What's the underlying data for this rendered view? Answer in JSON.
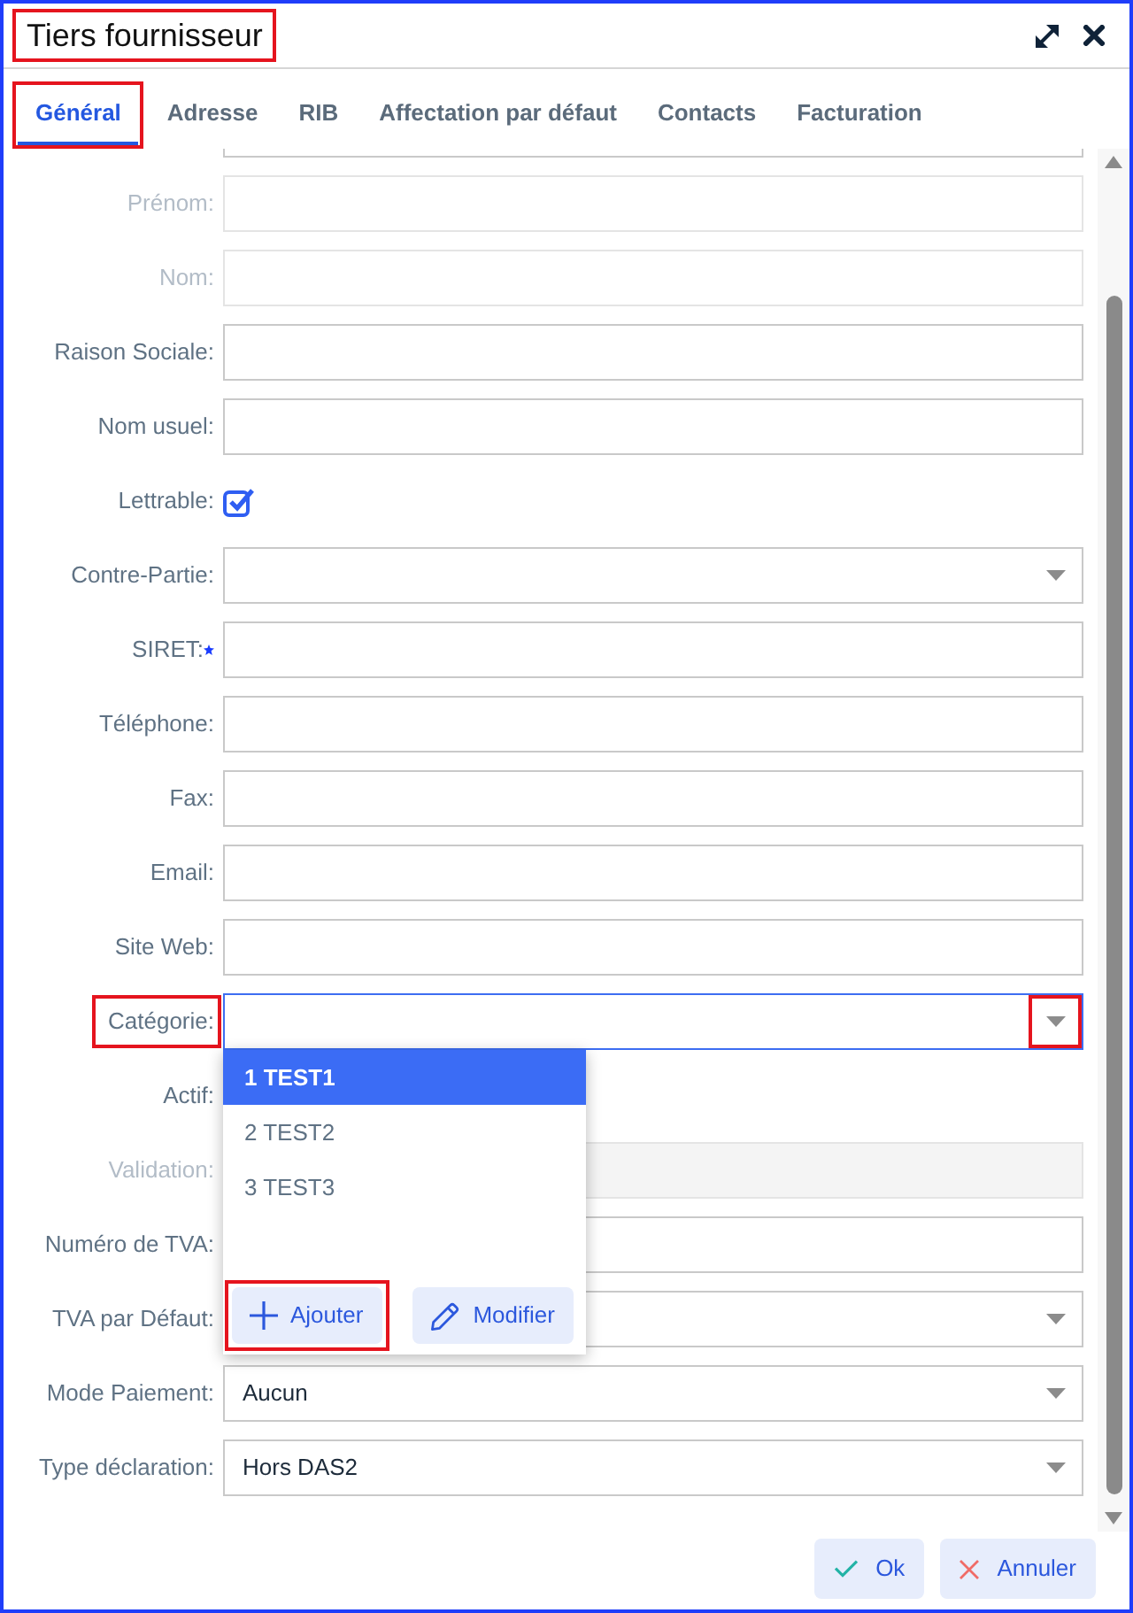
{
  "window": {
    "title": "Tiers fournisseur",
    "title_highlighted": true
  },
  "tabs": [
    {
      "label": "Général",
      "selected": true,
      "highlighted": true
    },
    {
      "label": "Adresse",
      "selected": false,
      "highlighted": false
    },
    {
      "label": "RIB",
      "selected": false,
      "highlighted": false
    },
    {
      "label": "Affectation par défaut",
      "selected": false,
      "highlighted": false
    },
    {
      "label": "Contacts",
      "selected": false,
      "highlighted": false
    },
    {
      "label": "Facturation",
      "selected": false,
      "highlighted": false
    }
  ],
  "fields": [
    {
      "kind": "clipped",
      "disabled": false
    },
    {
      "kind": "text",
      "label": "Prénom:",
      "disabled": true,
      "required": false
    },
    {
      "kind": "text",
      "label": "Nom:",
      "disabled": true,
      "required": false
    },
    {
      "kind": "text",
      "label": "Raison Sociale:",
      "disabled": false,
      "required": false
    },
    {
      "kind": "text",
      "label": "Nom usuel:",
      "disabled": false,
      "required": false
    },
    {
      "kind": "checkbox",
      "label": "Lettrable:",
      "disabled": false,
      "checked": true
    },
    {
      "kind": "select",
      "label": "Contre-Partie:",
      "disabled": false,
      "open": false
    },
    {
      "kind": "text",
      "label": "SIRET:",
      "disabled": false,
      "required": true
    },
    {
      "kind": "text",
      "label": "Téléphone:",
      "disabled": false,
      "required": false
    },
    {
      "kind": "text",
      "label": "Fax:",
      "disabled": false,
      "required": false
    },
    {
      "kind": "text",
      "label": "Email:",
      "disabled": false,
      "required": false
    },
    {
      "kind": "text",
      "label": "Site Web:",
      "disabled": false,
      "required": false
    },
    {
      "kind": "select",
      "label": "Catégorie:",
      "disabled": false,
      "open": true,
      "label_highlighted": true,
      "arrow_highlighted": true,
      "options": [
        {
          "label": "1 TEST1",
          "selected": true
        },
        {
          "label": "2 TEST2",
          "selected": false
        },
        {
          "label": "3 TEST3",
          "selected": false
        }
      ],
      "actions": [
        {
          "kind": "add",
          "label": "Ajouter",
          "highlighted": true
        },
        {
          "kind": "edit",
          "label": "Modifier",
          "highlighted": false
        }
      ]
    },
    {
      "kind": "covered",
      "label": "Actif:",
      "disabled": false
    },
    {
      "kind": "readonly",
      "label": "Validation:",
      "disabled": true
    },
    {
      "kind": "text",
      "label": "Numéro de TVA:",
      "disabled": false,
      "required": false
    },
    {
      "kind": "select",
      "label": "TVA par Défaut:",
      "disabled": false,
      "open": false
    },
    {
      "kind": "select",
      "label": "Mode Paiement:",
      "disabled": false,
      "open": false,
      "value": "Aucun"
    },
    {
      "kind": "select",
      "label": "Type déclaration:",
      "disabled": false,
      "open": false,
      "value": "Hors DAS2"
    }
  ],
  "footer_buttons": [
    {
      "kind": "confirm",
      "label": "Ok"
    },
    {
      "kind": "cancel",
      "label": "Annuler"
    }
  ]
}
